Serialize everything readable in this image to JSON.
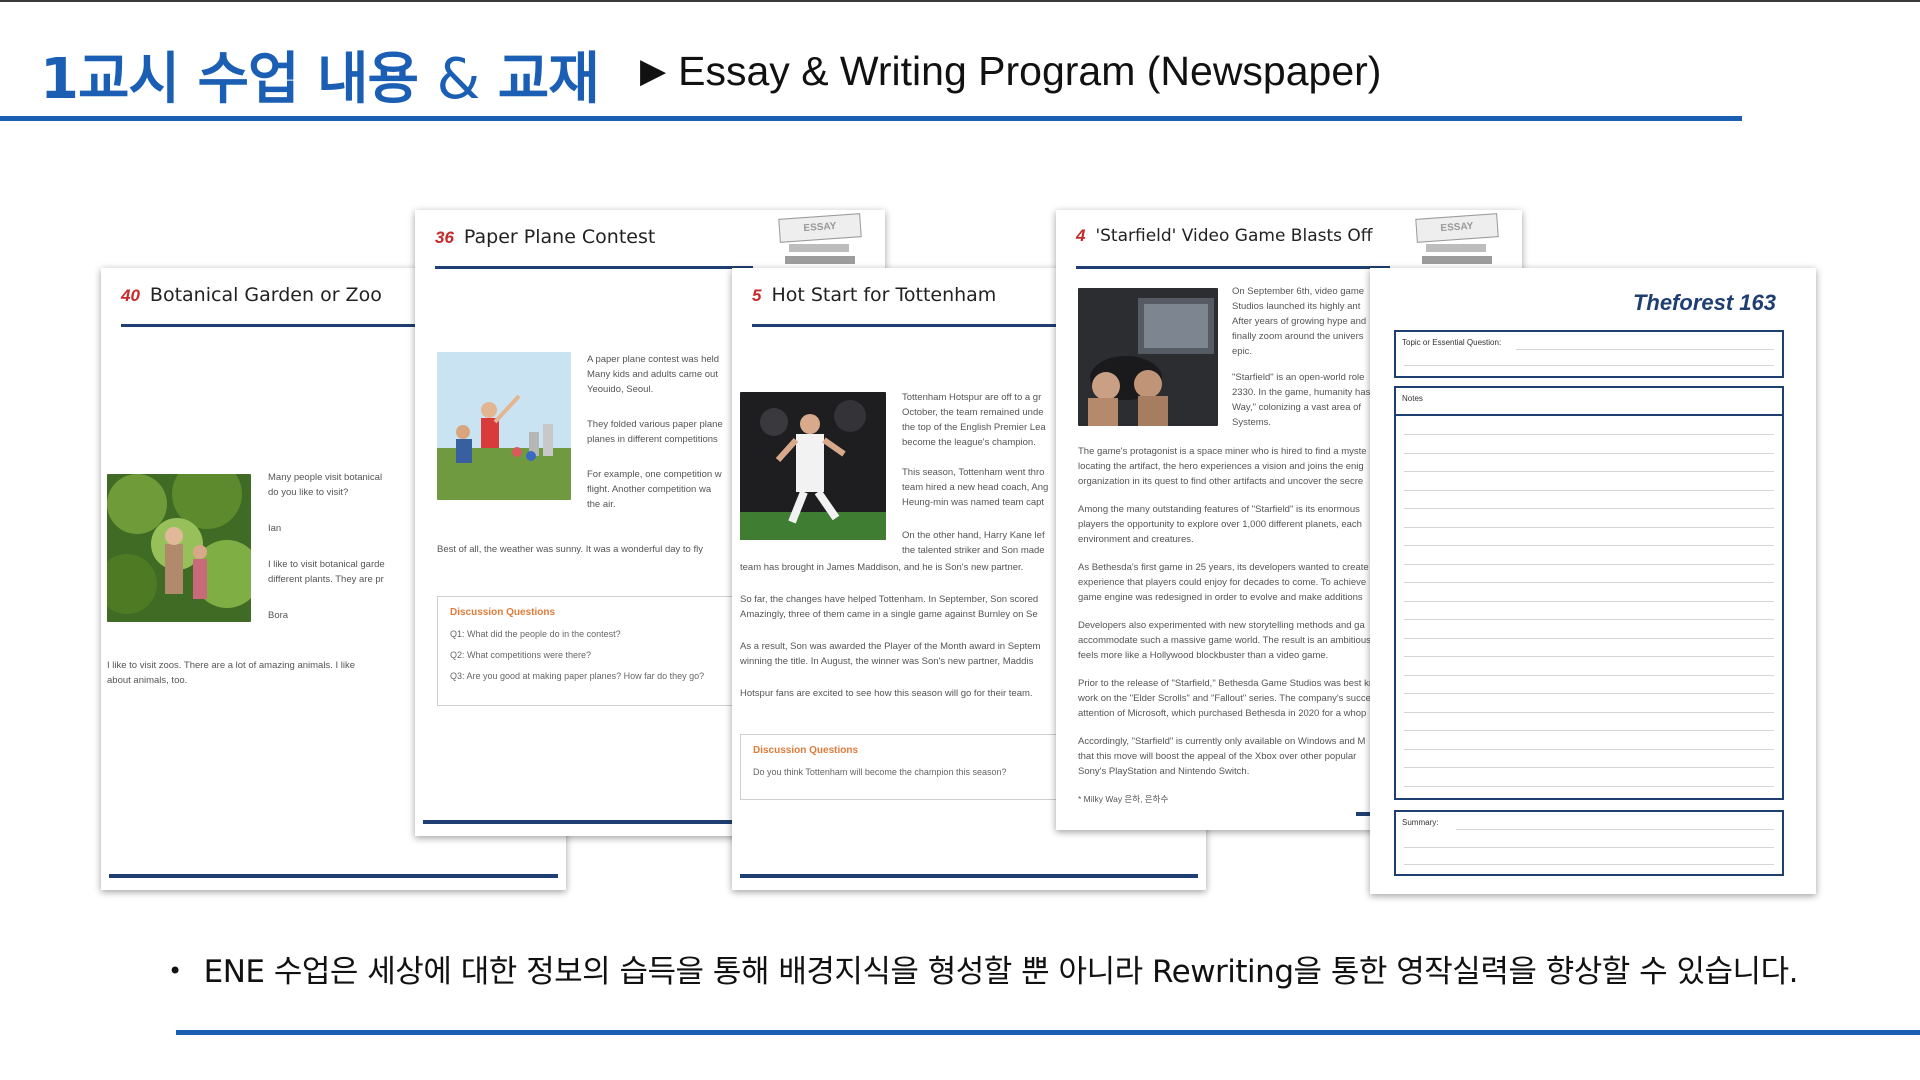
{
  "header": {
    "title_part1": "1교시 수업 내용",
    "title_amp": "&",
    "title_part2": "교재",
    "subtitle_marker": "▶",
    "subtitle": "Essay & Writing Program (Newspaper)"
  },
  "pages": {
    "zoo": {
      "number": "40",
      "title": "Botanical Garden or Zoo",
      "lines": [
        "Many people visit botanical",
        "do you like to visit?",
        "Ian",
        "I like to visit botanical garde",
        "different plants. They are pr",
        "Bora"
      ],
      "bottom": [
        "I like to visit zoos. There are a lot of amazing animals. I like",
        "about animals, too."
      ]
    },
    "plane": {
      "number": "36",
      "title": "Paper Plane Contest",
      "stamp": "ESSAY",
      "lines": [
        "A paper plane contest was held",
        "Many kids and adults came out",
        "Yeouido, Seoul.",
        "They folded various paper plane",
        "planes in different competitions",
        "For example, one competition w",
        "flight. Another competition wa",
        "the air."
      ],
      "wide": "Best of all, the weather was sunny. It was a wonderful day to fly",
      "disc_head": "Discussion Questions",
      "questions": [
        "Q1: What did the people do in the contest?",
        "Q2: What competitions were there?",
        "Q3: Are you good at making paper planes? How far do they go?"
      ]
    },
    "tottenham": {
      "number": "5",
      "title": "Hot Start for Tottenham",
      "lines": [
        "Tottenham Hotspur are off to a gr",
        "October, the team remained unde",
        "the top of the English Premier Lea",
        "become the league's champion.",
        "This season, Tottenham went thro",
        "team hired a new head coach, Ang",
        "Heung-min was named team capt",
        "On the other hand, Harry Kane lef",
        "the talented striker and Son made"
      ],
      "wide": [
        "team has brought in James Maddison, and he is Son's new partner.",
        "So far, the changes have helped Tottenham. In September, Son scored",
        "Amazingly, three of them came in a single game against Burnley on Se",
        "As a result, Son was awarded the Player of the Month award in Septem",
        "winning the title. In August, the winner was Son's new partner, Maddis",
        "Hotspur fans are excited to see how this season will go for their team."
      ],
      "disc_head": "Discussion Questions",
      "question": "Do you think Tottenham will become the champion this season?"
    },
    "starfield": {
      "number": "4",
      "title": "'Starfield' Video Game Blasts Off",
      "stamp": "ESSAY",
      "lines": [
        "On September 6th, video game",
        "Studios launched its highly ant",
        "After years of growing hype and",
        "finally zoom around the univers",
        "epic.",
        "\"Starfield\" is an open-world role",
        "2330. In the game, humanity has",
        "Way,\" colonizing a vast area of",
        "Systems."
      ],
      "wide": [
        "The game's protagonist is a space miner who is hired to find a myste",
        "locating the artifact, the hero experiences a vision and joins the enig",
        "organization in its quest to find other artifacts and uncover the secre",
        "Among the many outstanding features of \"Starfield\" is its enormous",
        "players the opportunity to explore over 1,000 different planets, each",
        "environment and creatures.",
        "As Bethesda's first game in 25 years, its developers wanted to create",
        "experience that players could enjoy for decades to come. To achieve",
        "game engine was redesigned in order to evolve and make additions",
        "Developers also experimented with new storytelling methods and ga",
        "accommodate such a massive game world. The result is an ambitious",
        "feels more like a Hollywood blockbuster than a video game.",
        "Prior to the release of \"Starfield,\" Bethesda Game Studios was best kn",
        "work on the \"Elder Scrolls\" and \"Fallout\" series. The company's succe",
        "attention of Microsoft, which purchased Bethesda in 2020 for a whop",
        "Accordingly, \"Starfield\" is currently only available on Windows and M",
        "that this move will boost the appeal of the Xbox over other popular",
        "Sony's PlayStation and Nintendo Switch."
      ],
      "footnote": "* Milky Way 은하, 은하수"
    },
    "worksheet": {
      "title": "Theforest 163",
      "topic_label": "Topic or Essential Question:",
      "notes_label": "Notes",
      "summary_label": "Summary:"
    }
  },
  "footer": {
    "bullet": "•",
    "text": "ENE 수업은 세상에 대한 정보의 습득을 통해 배경지식을 형성할 뿐 아니라 Rewriting을 통한 영작실력을 향상할 수 있습니다."
  }
}
